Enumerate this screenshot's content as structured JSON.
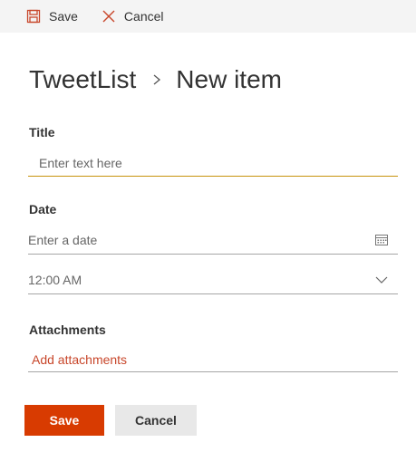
{
  "command_bar": {
    "save_label": "Save",
    "cancel_label": "Cancel"
  },
  "breadcrumb": {
    "list_name": "TweetList",
    "current": "New item"
  },
  "fields": {
    "title": {
      "label": "Title",
      "placeholder": "Enter text here",
      "value": ""
    },
    "date": {
      "label": "Date",
      "date_placeholder": "Enter a date",
      "time_value": "12:00 AM"
    },
    "attachments": {
      "label": "Attachments",
      "add_label": "Add attachments"
    }
  },
  "footer": {
    "save_label": "Save",
    "cancel_label": "Cancel"
  },
  "colors": {
    "accent": "#d83b01",
    "link": "#c8472b",
    "focus_underline": "#c8930c",
    "command_bar_bg": "#f4f4f4"
  },
  "icons": {
    "save": "floppy-disk-icon",
    "cancel": "close-icon",
    "separator": "chevron-right-icon",
    "calendar": "calendar-icon",
    "dropdown": "chevron-down-icon"
  }
}
